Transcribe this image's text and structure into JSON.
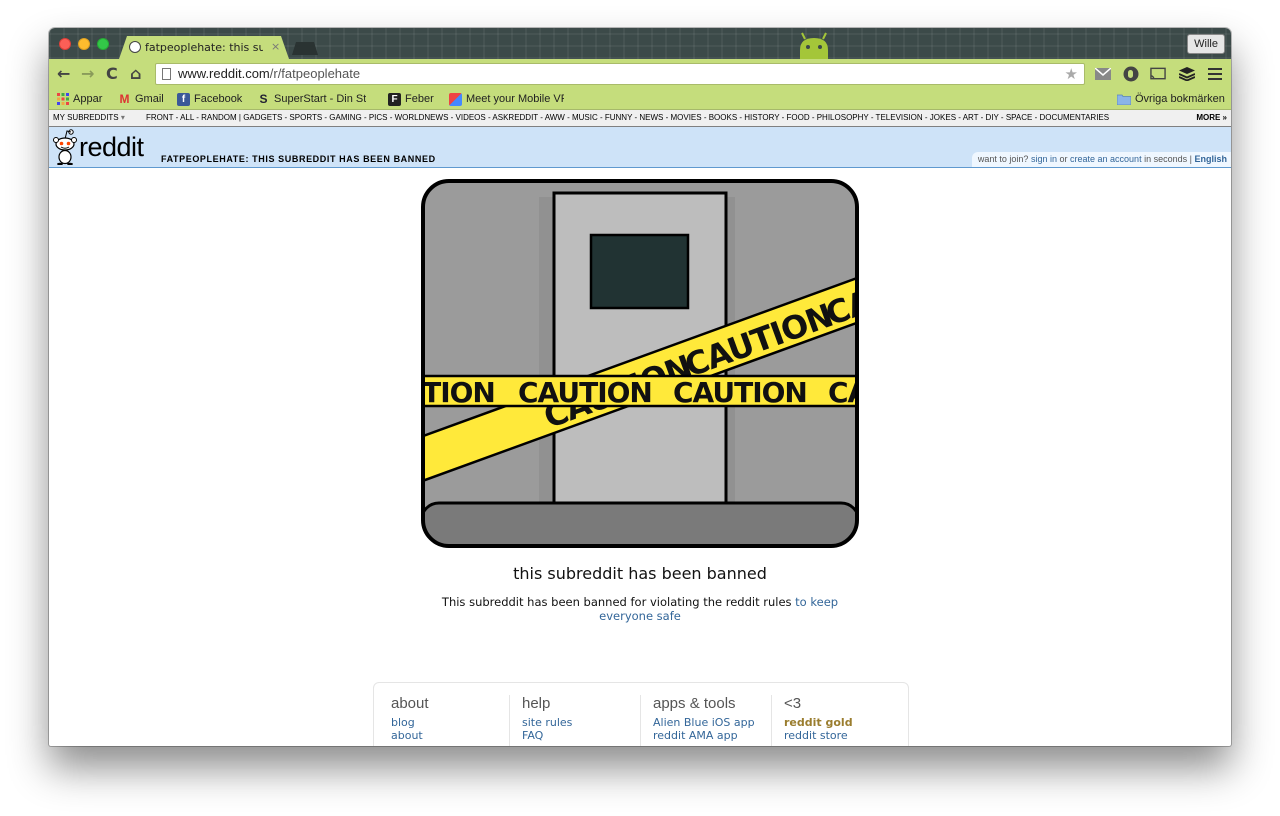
{
  "browser": {
    "tab_title": "fatpeoplehate: this subredd",
    "tab_close": "×",
    "profile": "Wille",
    "url_host": "www.reddit.com",
    "url_path": "/r/fatpeoplehate",
    "nav": {
      "back": "←",
      "forward": "→",
      "reload": "C",
      "home": "⌂"
    },
    "star": "★",
    "bookmarks": [
      {
        "label": "Appar",
        "icon": "apps-grid-icon"
      },
      {
        "label": "Gmail",
        "icon": "gmail-icon"
      },
      {
        "label": "Facebook",
        "icon": "facebook-icon"
      },
      {
        "label": "SuperStart - Din Sta",
        "icon": "superstart-icon"
      },
      {
        "label": "Feber",
        "icon": "feber-icon"
      },
      {
        "label": "Meet your Mobile VR",
        "icon": "puzzle-icon"
      }
    ],
    "other_bookmarks": "Övriga bokmärken"
  },
  "reddit": {
    "my_subreddits": "MY SUBREDDITS",
    "sr_links": "FRONT - ALL - RANDOM  |  GADGETS - SPORTS - GAMING - PICS - WORLDNEWS - VIDEOS - ASKREDDIT - AWW - MUSIC - FUNNY - NEWS - MOVIES - BOOKS - HISTORY - FOOD - PHILOSOPHY - TELEVISION - JOKES - ART - DIY - SPACE - DOCUMENTARIES",
    "more": "MORE »",
    "logo": "reddit",
    "pagename": "FATPEOPLEHATE: THIS SUBREDDIT HAS BEEN BANNED",
    "userbox": {
      "prefix": "want to join?",
      "signin": "sign in",
      "or": "or",
      "create": "create an account",
      "suffix": "in seconds |",
      "lang": "English"
    }
  },
  "content": {
    "caution_word": "CAUTION",
    "title": "this subreddit has been banned",
    "text_prefix": "This subreddit has been banned for violating the reddit rules",
    "text_link": "to keep everyone safe"
  },
  "footer": {
    "columns": [
      {
        "heading": "about",
        "links": [
          "blog",
          "about"
        ]
      },
      {
        "heading": "help",
        "links": [
          "site rules",
          "FAQ"
        ]
      },
      {
        "heading": "apps & tools",
        "links": [
          "Alien Blue iOS app",
          "reddit AMA app"
        ]
      },
      {
        "heading": "<3",
        "links": [
          "reddit gold",
          "reddit store"
        ]
      }
    ]
  },
  "colors": {
    "chrome_theme": "#c5dd7c",
    "reddit_header": "#cee3f8",
    "link": "#336699",
    "caution_yellow": "#ffe93a"
  }
}
